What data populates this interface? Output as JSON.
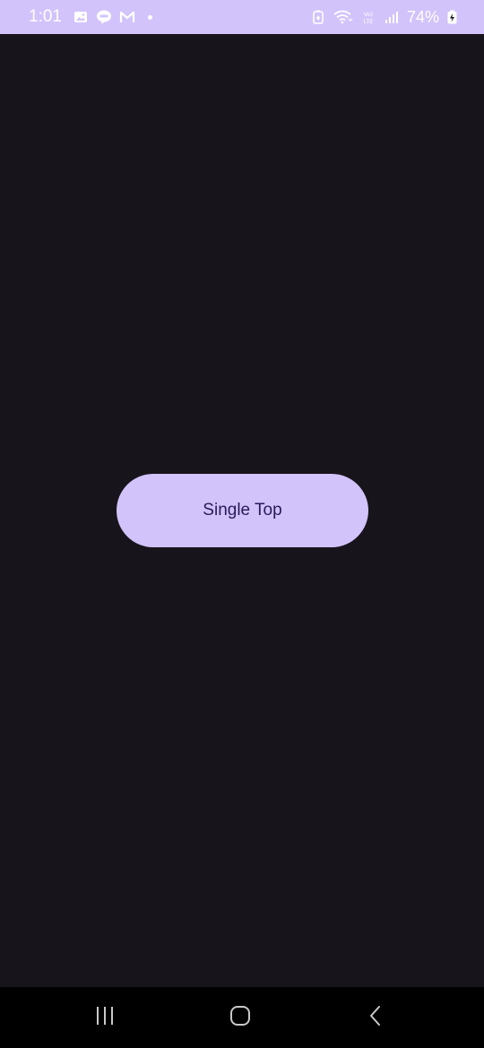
{
  "status_bar": {
    "time": "1:01",
    "battery_percent": "74%",
    "background_color": "#d2c3fb",
    "left_icons": [
      "gallery-icon",
      "line-app-icon",
      "gmail-icon",
      "notification-dot-icon"
    ],
    "right_icons": [
      "battery-saver-icon",
      "wifi-icon",
      "volte-icon",
      "signal-icon",
      "battery-charging-icon"
    ]
  },
  "main": {
    "background_color": "#18141c",
    "button": {
      "label": "Single Top",
      "background_color": "#d2c3fb",
      "text_color": "#2a1a5a"
    }
  },
  "nav_bar": {
    "buttons": [
      "recent-apps-icon",
      "home-icon",
      "back-icon"
    ]
  }
}
